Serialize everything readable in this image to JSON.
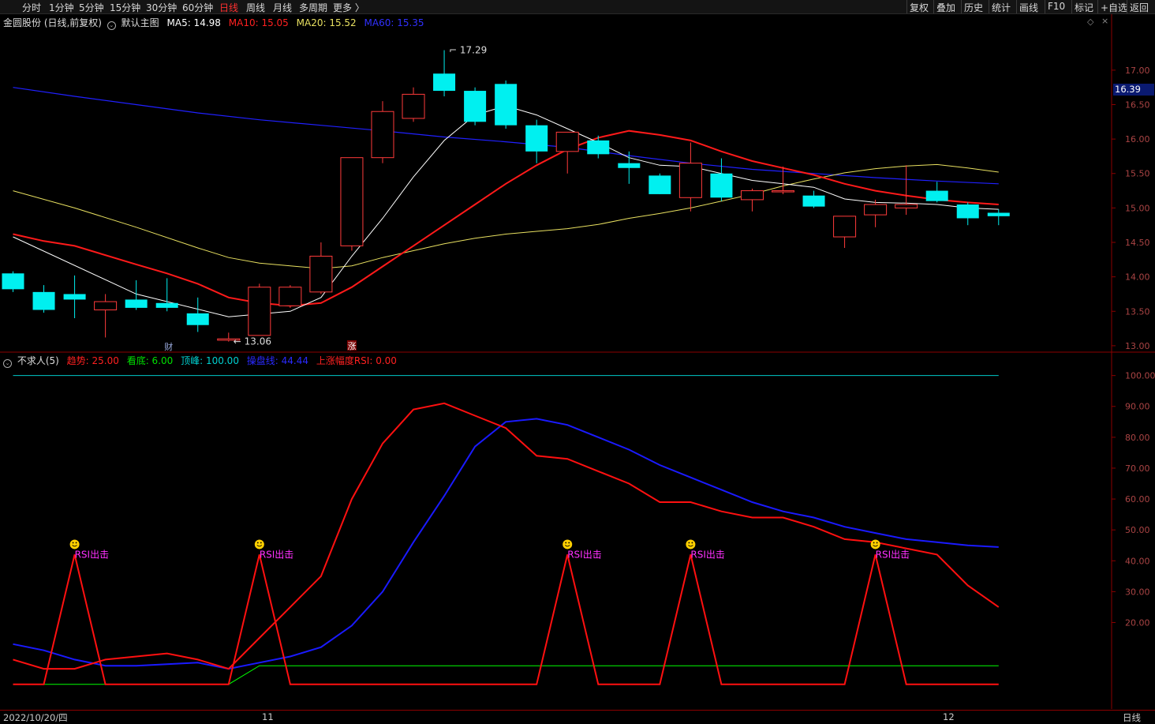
{
  "toolbar": {
    "left": [
      "分时",
      "1分钟",
      "5分钟",
      "15分钟",
      "30分钟",
      "60分钟",
      "日线",
      "周线",
      "月线",
      "多周期",
      "更多 〉"
    ],
    "active": "日线",
    "right": [
      "复权",
      "叠加",
      "历史",
      "统计",
      "画线",
      "F10",
      "标记",
      "+自选",
      "返回"
    ]
  },
  "main_legend": {
    "stock": "金圆股份 (日线,前复权)",
    "chart_name": "默认主图",
    "ma5": "MA5: 14.98",
    "ma10": "MA10: 15.05",
    "ma20": "MA20: 15.52",
    "ma60": "MA60: 15.35"
  },
  "sub_legend": {
    "name": "不求人(5)",
    "trend": "趋势: 25.00",
    "bottom": "看底: 6.00",
    "top": "顶峰: 100.00",
    "sideways": "操盘线: 44.44",
    "rsi": "上涨幅度RSI: 0.00"
  },
  "annotations": {
    "high": "17.29",
    "low": "13.06",
    "cai": "财",
    "zhang": "涨",
    "signal": "RSI出击"
  },
  "price_label": "16.39",
  "bottom_bar": {
    "date": "2022/10/20/四",
    "month11": "11",
    "month12": "12",
    "period": "日线"
  },
  "colors": {
    "up": "#ff3b3b",
    "down": "#00f0f0",
    "ma5": "#ffffff",
    "ma10": "#ff1a1a",
    "ma20": "#e8e060",
    "ma60": "#2020ff",
    "trend": "#ff1010",
    "bottom": "#00ff00",
    "top": "#00c8c8",
    "sideways": "#1a1aff",
    "signal": "#ff30ff"
  },
  "chart_data": [
    {
      "type": "candlestick",
      "yticks": [
        13.0,
        13.5,
        14.0,
        14.5,
        15.0,
        15.5,
        16.0,
        16.5,
        17.0
      ],
      "ylim": [
        12.93,
        17.56
      ],
      "candles": [
        {
          "o": 14.05,
          "h": 14.08,
          "l": 13.78,
          "c": 13.82
        },
        {
          "o": 13.78,
          "h": 13.88,
          "l": 13.48,
          "c": 13.52
        },
        {
          "o": 13.75,
          "h": 14.02,
          "l": 13.4,
          "c": 13.67
        },
        {
          "o": 13.52,
          "h": 13.75,
          "l": 13.12,
          "c": 13.64
        },
        {
          "o": 13.67,
          "h": 13.95,
          "l": 13.52,
          "c": 13.55
        },
        {
          "o": 13.62,
          "h": 13.98,
          "l": 13.5,
          "c": 13.55
        },
        {
          "o": 13.47,
          "h": 13.7,
          "l": 13.2,
          "c": 13.3
        },
        {
          "o": 13.08,
          "h": 13.19,
          "l": 13.06,
          "c": 13.1
        },
        {
          "o": 13.15,
          "h": 13.9,
          "l": 13.15,
          "c": 13.85
        },
        {
          "o": 13.58,
          "h": 13.88,
          "l": 13.55,
          "c": 13.85
        },
        {
          "o": 13.78,
          "h": 14.5,
          "l": 13.75,
          "c": 14.3
        },
        {
          "o": 14.45,
          "h": 15.2,
          "l": 14.38,
          "c": 15.73
        },
        {
          "o": 15.73,
          "h": 16.55,
          "l": 15.65,
          "c": 16.4
        },
        {
          "o": 16.3,
          "h": 16.75,
          "l": 16.25,
          "c": 16.65
        },
        {
          "o": 16.95,
          "h": 17.29,
          "l": 16.62,
          "c": 16.7
        },
        {
          "o": 16.7,
          "h": 16.75,
          "l": 16.2,
          "c": 16.25
        },
        {
          "o": 16.8,
          "h": 16.85,
          "l": 16.15,
          "c": 16.2
        },
        {
          "o": 16.2,
          "h": 16.28,
          "l": 15.65,
          "c": 15.82
        },
        {
          "o": 15.82,
          "h": 16.1,
          "l": 15.5,
          "c": 16.1
        },
        {
          "o": 15.98,
          "h": 16.05,
          "l": 15.72,
          "c": 15.78
        },
        {
          "o": 15.65,
          "h": 15.82,
          "l": 15.35,
          "c": 15.58
        },
        {
          "o": 15.47,
          "h": 15.5,
          "l": 15.2,
          "c": 15.2
        },
        {
          "o": 15.15,
          "h": 15.95,
          "l": 14.95,
          "c": 15.65
        },
        {
          "o": 15.5,
          "h": 15.72,
          "l": 15.1,
          "c": 15.15
        },
        {
          "o": 15.12,
          "h": 15.28,
          "l": 14.95,
          "c": 15.25
        },
        {
          "o": 15.25,
          "h": 15.6,
          "l": 15.2,
          "c": 15.25
        },
        {
          "o": 15.18,
          "h": 15.25,
          "l": 15.0,
          "c": 15.02
        },
        {
          "o": 14.58,
          "h": 14.88,
          "l": 14.42,
          "c": 14.88
        },
        {
          "o": 14.9,
          "h": 15.12,
          "l": 14.72,
          "c": 15.05
        },
        {
          "o": 15.0,
          "h": 15.62,
          "l": 14.9,
          "c": 15.05
        },
        {
          "o": 15.25,
          "h": 15.38,
          "l": 15.08,
          "c": 15.1
        },
        {
          "o": 15.05,
          "h": 15.08,
          "l": 14.75,
          "c": 14.85
        },
        {
          "o": 14.93,
          "h": 14.98,
          "l": 14.75,
          "c": 14.88
        }
      ],
      "ma5": [
        [
          0,
          14.58
        ],
        [
          4,
          13.75
        ],
        [
          7,
          13.42
        ],
        [
          9,
          13.5
        ],
        [
          10,
          13.7
        ],
        [
          11,
          14.3
        ],
        [
          12,
          14.85
        ],
        [
          13,
          15.45
        ],
        [
          14,
          15.98
        ],
        [
          15,
          16.35
        ],
        [
          16,
          16.48
        ],
        [
          17,
          16.35
        ],
        [
          18,
          16.15
        ],
        [
          19,
          15.95
        ],
        [
          20,
          15.73
        ],
        [
          21,
          15.62
        ],
        [
          22,
          15.6
        ],
        [
          23,
          15.5
        ],
        [
          24,
          15.4
        ],
        [
          25,
          15.35
        ],
        [
          26,
          15.3
        ],
        [
          27,
          15.13
        ],
        [
          28,
          15.08
        ],
        [
          29,
          15.07
        ],
        [
          30,
          15.05
        ],
        [
          31,
          15.0
        ],
        [
          32,
          14.98
        ]
      ],
      "ma10": [
        [
          0,
          14.62
        ],
        [
          1,
          14.52
        ],
        [
          2,
          14.45
        ],
        [
          4,
          14.18
        ],
        [
          5,
          14.05
        ],
        [
          6,
          13.9
        ],
        [
          7,
          13.7
        ],
        [
          8,
          13.62
        ],
        [
          9,
          13.58
        ],
        [
          10,
          13.62
        ],
        [
          11,
          13.85
        ],
        [
          12,
          14.15
        ],
        [
          13,
          14.45
        ],
        [
          14,
          14.75
        ],
        [
          15,
          15.05
        ],
        [
          16,
          15.35
        ],
        [
          17,
          15.62
        ],
        [
          18,
          15.85
        ],
        [
          19,
          16.02
        ],
        [
          20,
          16.12
        ],
        [
          21,
          16.06
        ],
        [
          22,
          15.98
        ],
        [
          23,
          15.82
        ],
        [
          24,
          15.68
        ],
        [
          25,
          15.58
        ],
        [
          26,
          15.48
        ],
        [
          27,
          15.35
        ],
        [
          28,
          15.25
        ],
        [
          29,
          15.18
        ],
        [
          30,
          15.12
        ],
        [
          31,
          15.08
        ],
        [
          32,
          15.05
        ]
      ],
      "ma20": [
        [
          0,
          15.25
        ],
        [
          2,
          15.0
        ],
        [
          4,
          14.72
        ],
        [
          6,
          14.42
        ],
        [
          7,
          14.28
        ],
        [
          8,
          14.2
        ],
        [
          9,
          14.16
        ],
        [
          10,
          14.12
        ],
        [
          11,
          14.16
        ],
        [
          12,
          14.28
        ],
        [
          13,
          14.38
        ],
        [
          14,
          14.48
        ],
        [
          15,
          14.56
        ],
        [
          16,
          14.62
        ],
        [
          17,
          14.66
        ],
        [
          18,
          14.7
        ],
        [
          19,
          14.76
        ],
        [
          20,
          14.85
        ],
        [
          21,
          14.92
        ],
        [
          22,
          15.0
        ],
        [
          23,
          15.1
        ],
        [
          24,
          15.2
        ],
        [
          25,
          15.32
        ],
        [
          26,
          15.42
        ],
        [
          27,
          15.51
        ],
        [
          28,
          15.57
        ],
        [
          29,
          15.61
        ],
        [
          30,
          15.63
        ],
        [
          31,
          15.58
        ],
        [
          32,
          15.52
        ]
      ],
      "ma60": [
        [
          0,
          16.75
        ],
        [
          2,
          16.62
        ],
        [
          4,
          16.5
        ],
        [
          6,
          16.38
        ],
        [
          8,
          16.28
        ],
        [
          10,
          16.2
        ],
        [
          12,
          16.12
        ],
        [
          14,
          16.03
        ],
        [
          16,
          15.96
        ],
        [
          18,
          15.88
        ],
        [
          20,
          15.76
        ],
        [
          22,
          15.65
        ],
        [
          24,
          15.56
        ],
        [
          26,
          15.5
        ],
        [
          28,
          15.44
        ],
        [
          30,
          15.39
        ],
        [
          32,
          15.35
        ]
      ]
    },
    {
      "type": "line",
      "yticks": [
        20.0,
        30.0,
        40.0,
        50.0,
        60.0,
        70.0,
        80.0,
        90.0,
        100.0
      ],
      "ylim": [
        -7.5,
        104
      ],
      "series": [
        {
          "name": "趋势",
          "values": [
            8,
            5,
            5,
            8,
            9,
            10,
            8,
            5,
            15,
            25,
            35,
            60,
            78,
            89,
            91,
            87,
            83,
            74,
            73,
            69,
            65,
            59,
            59,
            56,
            54,
            54,
            51,
            47,
            46,
            44,
            42,
            32,
            25
          ]
        },
        {
          "name": "看底",
          "values": [
            0,
            0,
            0,
            0,
            0,
            0,
            0,
            0,
            6,
            6,
            6,
            6,
            6,
            6,
            6,
            6,
            6,
            6,
            6,
            6,
            6,
            6,
            6,
            6,
            6,
            6,
            6,
            6,
            6,
            6,
            6,
            6,
            6
          ]
        },
        {
          "name": "顶峰",
          "values": [
            100,
            100,
            100,
            100,
            100,
            100,
            100,
            100,
            100,
            100,
            100,
            100,
            100,
            100,
            100,
            100,
            100,
            100,
            100,
            100,
            100,
            100,
            100,
            100,
            100,
            100,
            100,
            100,
            100,
            100,
            100,
            100,
            100
          ]
        },
        {
          "name": "操盘线",
          "values": [
            13,
            11,
            8,
            6,
            6,
            6.5,
            7,
            5,
            7,
            9,
            12,
            19,
            30,
            46,
            61,
            77,
            85,
            86,
            84,
            80,
            76,
            71,
            67,
            63,
            59,
            56,
            54,
            51,
            49,
            47,
            46,
            45,
            44.44
          ]
        },
        {
          "name": "上涨幅度RSI",
          "values": [
            0,
            0,
            42,
            0,
            0,
            0,
            0,
            0,
            42,
            0,
            0,
            0,
            0,
            0,
            0,
            0,
            0,
            0,
            42,
            0,
            0,
            0,
            42,
            0,
            0,
            0,
            0,
            0,
            42,
            0,
            0,
            0,
            0
          ]
        }
      ],
      "signals": [
        2,
        8,
        18,
        22,
        28
      ]
    }
  ]
}
